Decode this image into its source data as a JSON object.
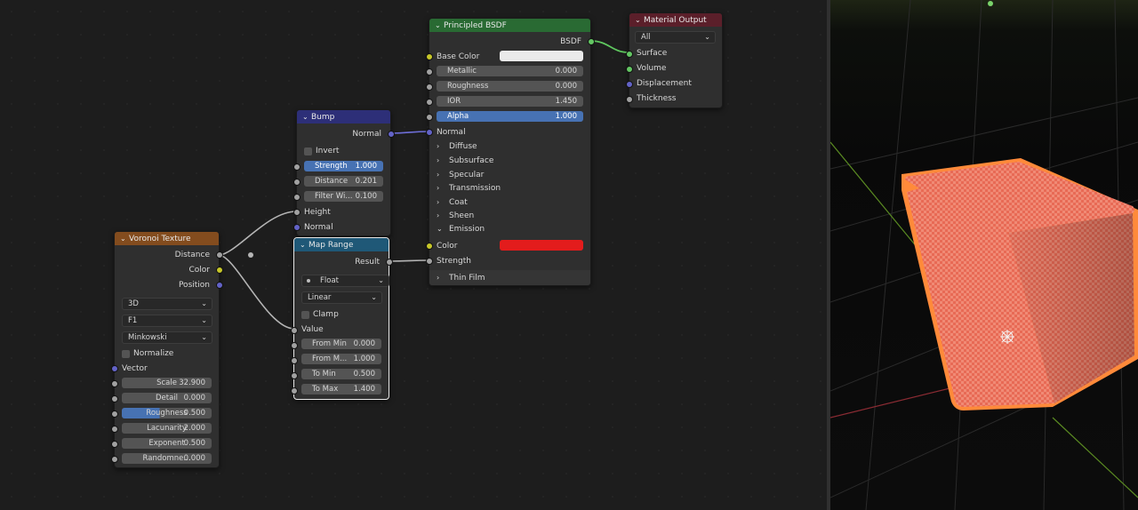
{
  "colors": {
    "texture_header": "#834c1e",
    "vector_header": "#2d2f78",
    "converter_header": "#1f5877",
    "shader_header": "#296a33",
    "output_header": "#5b1f2a",
    "field_active": "#4772b3",
    "emission_color": "#e31c1c",
    "base_color": "#eaeaea",
    "selection_outline": "#ff8a3a"
  },
  "voronoi": {
    "title": "Voronoi Texture",
    "outputs": [
      "Distance",
      "Color",
      "Position"
    ],
    "dim": "3D",
    "feature": "F1",
    "metric": "Minkowski",
    "normalize_label": "Normalize",
    "vector_label": "Vector",
    "fields": [
      {
        "label": "Scale",
        "value": "32.900"
      },
      {
        "label": "Detail",
        "value": "0.000"
      },
      {
        "label": "Roughness",
        "value": "0.500"
      },
      {
        "label": "Lacunarity",
        "value": "2.000"
      },
      {
        "label": "Exponent",
        "value": "0.500"
      },
      {
        "label": "Randomne...",
        "value": "0.000"
      }
    ]
  },
  "bump": {
    "title": "Bump",
    "output": "Normal",
    "invert_label": "Invert",
    "fields": [
      {
        "label": "Strength",
        "value": "1.000"
      },
      {
        "label": "Distance",
        "value": "0.201"
      },
      {
        "label": "Filter Wi...",
        "value": "0.100"
      }
    ],
    "height_label": "Height",
    "normal_label": "Normal"
  },
  "map_range": {
    "title": "Map Range",
    "output": "Result",
    "data_type": "Float",
    "interp": "Linear",
    "clamp_label": "Clamp",
    "value_label": "Value",
    "fields": [
      {
        "label": "From Min",
        "value": "0.000"
      },
      {
        "label": "From M...",
        "value": "1.000"
      },
      {
        "label": "To Min",
        "value": "0.500"
      },
      {
        "label": "To Max",
        "value": "1.400"
      }
    ]
  },
  "bsdf": {
    "title": "Principled BSDF",
    "output": "BSDF",
    "base_color_label": "Base Color",
    "fields": [
      {
        "label": "Metallic",
        "value": "0.000"
      },
      {
        "label": "Roughness",
        "value": "0.000"
      },
      {
        "label": "IOR",
        "value": "1.450"
      },
      {
        "label": "Alpha",
        "value": "1.000"
      }
    ],
    "normal_label": "Normal",
    "panels": [
      "Diffuse",
      "Subsurface",
      "Specular",
      "Transmission",
      "Coat",
      "Sheen"
    ],
    "emission_label": "Emission",
    "color_label": "Color",
    "strength_label": "Strength",
    "thin_film_label": "Thin Film"
  },
  "output": {
    "title": "Material Output",
    "target": "All",
    "inputs": [
      "Surface",
      "Volume",
      "Displacement",
      "Thickness"
    ]
  }
}
